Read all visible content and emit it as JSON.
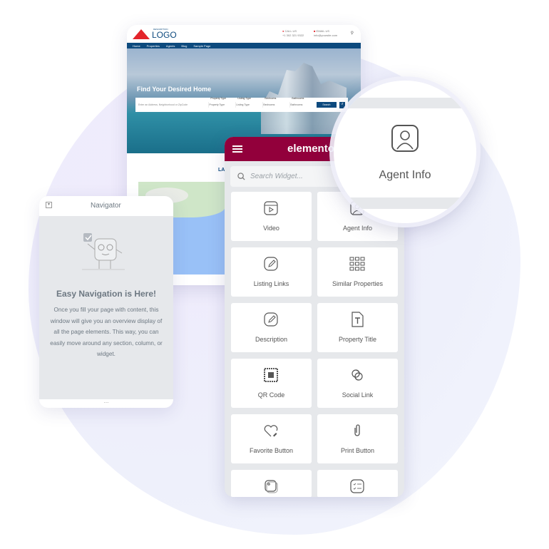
{
  "website": {
    "logo_sub": "DESCRIPTION",
    "logo": "LOGO",
    "call_label": "CALL US",
    "call_value": "+1 302 321 9322",
    "email_label": "EMAIL US",
    "email_value": "info@yoursite.com",
    "nav": [
      "Home",
      "Properties",
      "Agents",
      "Blog",
      "Sample Page"
    ],
    "hero_title": "Find Your Desired Home",
    "search": {
      "placeholder": "Enter an Address, Neighborhood or ZipCode",
      "fields": [
        {
          "label": "Property Type",
          "value": "Property Type"
        },
        {
          "label": "Listing Type",
          "value": "Listing Type"
        },
        {
          "label": "Bedrooms",
          "value": "Bedrooms"
        },
        {
          "label": "Bathrooms",
          "value": "Bathrooms"
        }
      ],
      "button": "Search"
    },
    "section_heading": "LA"
  },
  "navigator": {
    "title": "Navigator",
    "heading": "Easy Navigation is Here!",
    "body": "Once you fill your page with content, this window will give you an overview display of all the page elements. This way, you can easily move around any section, column, or widget.",
    "footer": "..."
  },
  "elementor": {
    "brand": "elementor",
    "search_placeholder": "Search Widget...",
    "accent": "#92003b",
    "widgets": [
      {
        "label": "Video",
        "icon": "video-icon"
      },
      {
        "label": "Agent Info",
        "icon": "agent-icon"
      },
      {
        "label": "Listing Links",
        "icon": "pencil-icon"
      },
      {
        "label": "Similar Properties",
        "icon": "grid-icon"
      },
      {
        "label": "Description",
        "icon": "pencil-icon"
      },
      {
        "label": "Property Title",
        "icon": "text-icon"
      },
      {
        "label": "QR Code",
        "icon": "qr-icon"
      },
      {
        "label": "Social Link",
        "icon": "link-icon"
      },
      {
        "label": "Favorite Button",
        "icon": "heart-icon"
      },
      {
        "label": "Print Button",
        "icon": "clip-icon"
      },
      {
        "label": "",
        "icon": "box-icon"
      },
      {
        "label": "",
        "icon": "checklist-icon"
      }
    ]
  },
  "magnifier": {
    "label": "Agent Info",
    "icon": "agent-icon"
  }
}
